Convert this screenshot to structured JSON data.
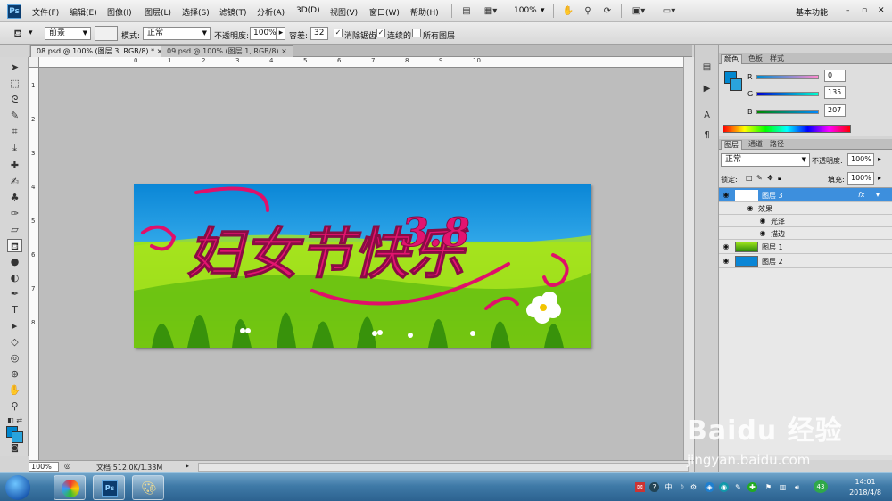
{
  "app": {
    "logo": "Ps",
    "workspace": "基本功能"
  },
  "menu": [
    "文件(F)",
    "编辑(E)",
    "图像(I)",
    "图层(L)",
    "选择(S)",
    "滤镜(T)",
    "分析(A)",
    "3D(D)",
    "视图(V)",
    "窗口(W)",
    "帮助(H)"
  ],
  "menubar": {
    "zoom": "100%"
  },
  "options": {
    "fill_source": "前景",
    "mode_label": "模式:",
    "mode_value": "正常",
    "opacity_label": "不透明度:",
    "opacity_value": "100%",
    "tolerance_label": "容差:",
    "tolerance_value": "32",
    "antialias_label": "消除锯齿",
    "contiguous_label": "连续的",
    "alllayers_label": "所有图层"
  },
  "tabs": [
    {
      "label": "08.psd @ 100% (图层 3, RGB/8) *",
      "close": "×"
    },
    {
      "label": "09.psd @ 100% (图层 1, RGB/8)",
      "close": "×"
    }
  ],
  "ruler": {
    "h": [
      "0",
      "1",
      "2",
      "3",
      "4",
      "5",
      "6",
      "7",
      "8",
      "9",
      "10"
    ],
    "v": [
      "1",
      "2",
      "3",
      "4",
      "5",
      "6",
      "7",
      "8"
    ]
  },
  "artwork": {
    "title": "妇女节快乐",
    "number": "3.8"
  },
  "status": {
    "zoom": "100%",
    "doc": "文档:512.0K/1.33M"
  },
  "color_panel": {
    "tabs": [
      "颜色",
      "色板",
      "样式"
    ],
    "r_label": "R",
    "r_value": "0",
    "g_label": "G",
    "g_value": "135",
    "b_label": "B",
    "b_value": "207",
    "foreground_color": "#0087cf"
  },
  "layers_panel": {
    "tabs": [
      "图层",
      "通道",
      "路径"
    ],
    "blend_mode": "正常",
    "opacity_label": "不透明度:",
    "opacity_value": "100%",
    "lock_label": "锁定:",
    "fill_label": "填充:",
    "fill_value": "100%",
    "fx": "fx",
    "layers": [
      {
        "name": "图层 3",
        "selected": true
      },
      {
        "name": "效果",
        "sub": true
      },
      {
        "name": "光泽",
        "sub": true
      },
      {
        "name": "描边",
        "sub": true
      },
      {
        "name": "图层 1"
      },
      {
        "name": "图层 2"
      }
    ]
  },
  "taskbar": {
    "tray_badge": "43",
    "ime": "中",
    "time": "14:01",
    "date": "2018/4/8"
  },
  "watermark": {
    "brand": "Baidu 经验",
    "url": "jingyan.baidu.com"
  }
}
